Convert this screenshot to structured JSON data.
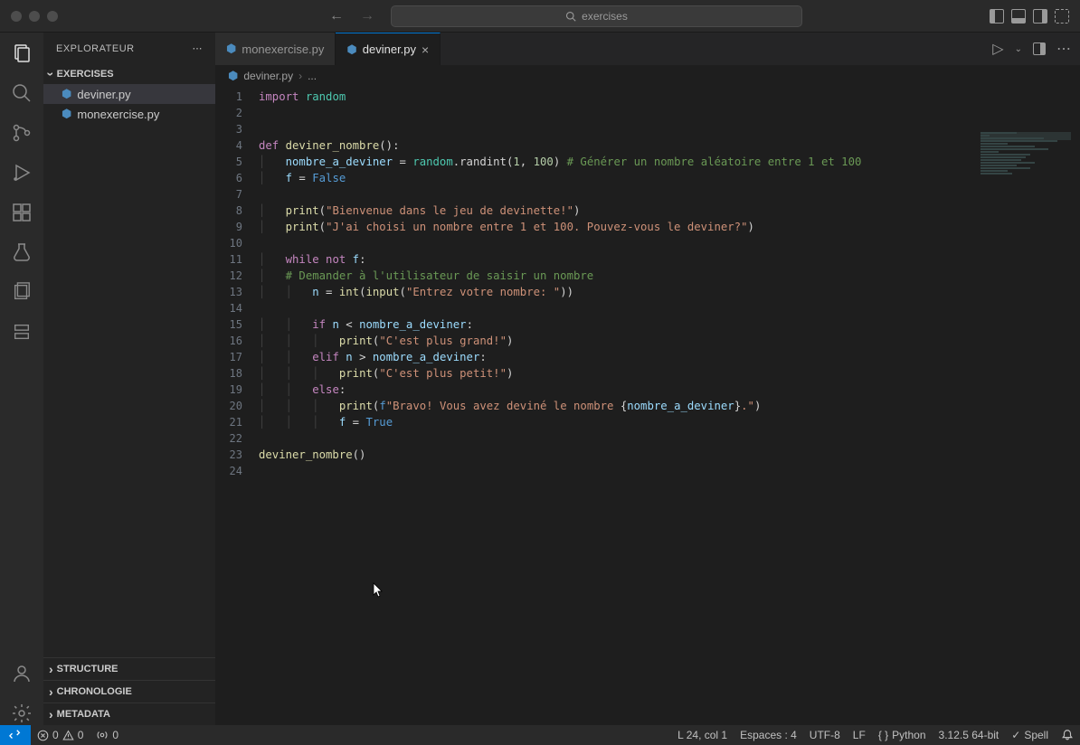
{
  "search": {
    "placeholder": "exercises"
  },
  "sidebar": {
    "title": "EXPLORATEUR",
    "section": "EXERCISES",
    "files": [
      {
        "name": "deviner.py",
        "active": true
      },
      {
        "name": "monexercise.py",
        "active": false
      }
    ],
    "collapsed": [
      "STRUCTURE",
      "CHRONOLOGIE",
      "METADATA"
    ]
  },
  "tabs": [
    {
      "name": "monexercise.py",
      "active": false
    },
    {
      "name": "deviner.py",
      "active": true
    }
  ],
  "breadcrumbs": {
    "file": "deviner.py",
    "more": "..."
  },
  "code_lines": [
    [
      {
        "t": "import ",
        "c": "kw"
      },
      {
        "t": "random",
        "c": "mod"
      }
    ],
    [],
    [],
    [
      {
        "t": "def ",
        "c": "kw"
      },
      {
        "t": "deviner_nombre",
        "c": "fn"
      },
      {
        "t": "():",
        "c": ""
      }
    ],
    [
      {
        "t": "    "
      },
      {
        "t": "nombre_a_deviner",
        "c": "param"
      },
      {
        "t": " = "
      },
      {
        "t": "random",
        "c": "mod"
      },
      {
        "t": ".randint("
      },
      {
        "t": "1",
        "c": "num"
      },
      {
        "t": ", "
      },
      {
        "t": "100",
        "c": "num"
      },
      {
        "t": ") "
      },
      {
        "t": "# Générer un nombre aléatoire entre 1 et 100",
        "c": "com"
      }
    ],
    [
      {
        "t": "    "
      },
      {
        "t": "f",
        "c": "param"
      },
      {
        "t": " = "
      },
      {
        "t": "False",
        "c": "const"
      }
    ],
    [],
    [
      {
        "t": "    "
      },
      {
        "t": "print",
        "c": "fn"
      },
      {
        "t": "("
      },
      {
        "t": "\"Bienvenue dans le jeu de devinette!\"",
        "c": "str"
      },
      {
        "t": ")"
      }
    ],
    [
      {
        "t": "    "
      },
      {
        "t": "print",
        "c": "fn"
      },
      {
        "t": "("
      },
      {
        "t": "\"J'ai choisi un nombre entre 1 et 100. Pouvez-vous le deviner?\"",
        "c": "str"
      },
      {
        "t": ")"
      }
    ],
    [],
    [
      {
        "t": "    "
      },
      {
        "t": "while ",
        "c": "kw"
      },
      {
        "t": "not ",
        "c": "kw"
      },
      {
        "t": "f",
        "c": "param"
      },
      {
        "t": ":"
      }
    ],
    [
      {
        "t": "    "
      },
      {
        "t": "# Demander à l'utilisateur de saisir un nombre",
        "c": "com"
      }
    ],
    [
      {
        "t": "        "
      },
      {
        "t": "n",
        "c": "param"
      },
      {
        "t": " = "
      },
      {
        "t": "int",
        "c": "fn"
      },
      {
        "t": "("
      },
      {
        "t": "input",
        "c": "fn"
      },
      {
        "t": "("
      },
      {
        "t": "\"Entrez votre nombre: \"",
        "c": "str"
      },
      {
        "t": "))"
      }
    ],
    [],
    [
      {
        "t": "        "
      },
      {
        "t": "if ",
        "c": "kw"
      },
      {
        "t": "n",
        "c": "param"
      },
      {
        "t": " < "
      },
      {
        "t": "nombre_a_deviner",
        "c": "param"
      },
      {
        "t": ":"
      }
    ],
    [
      {
        "t": "            "
      },
      {
        "t": "print",
        "c": "fn"
      },
      {
        "t": "("
      },
      {
        "t": "\"C'est plus grand!\"",
        "c": "str"
      },
      {
        "t": ")"
      }
    ],
    [
      {
        "t": "        "
      },
      {
        "t": "elif ",
        "c": "kw"
      },
      {
        "t": "n",
        "c": "param"
      },
      {
        "t": " > "
      },
      {
        "t": "nombre_a_deviner",
        "c": "param"
      },
      {
        "t": ":"
      }
    ],
    [
      {
        "t": "            "
      },
      {
        "t": "print",
        "c": "fn"
      },
      {
        "t": "("
      },
      {
        "t": "\"C'est plus petit!\"",
        "c": "str"
      },
      {
        "t": ")"
      }
    ],
    [
      {
        "t": "        "
      },
      {
        "t": "else",
        "c": "kw"
      },
      {
        "t": ":"
      }
    ],
    [
      {
        "t": "            "
      },
      {
        "t": "print",
        "c": "fn"
      },
      {
        "t": "("
      },
      {
        "t": "f",
        "c": "const"
      },
      {
        "t": "\"Bravo! Vous avez deviné le nombre ",
        "c": "str"
      },
      {
        "t": "{",
        "c": ""
      },
      {
        "t": "nombre_a_deviner",
        "c": "param"
      },
      {
        "t": "}",
        "c": ""
      },
      {
        "t": ".\"",
        "c": "str"
      },
      {
        "t": ")"
      }
    ],
    [
      {
        "t": "            "
      },
      {
        "t": "f",
        "c": "param"
      },
      {
        "t": " = "
      },
      {
        "t": "True",
        "c": "const"
      }
    ],
    [],
    [
      {
        "t": "deviner_nombre",
        "c": "fn"
      },
      {
        "t": "()"
      }
    ],
    []
  ],
  "status": {
    "errors": "0",
    "warnings": "0",
    "ports": "0",
    "position": "L 24, col 1",
    "spaces": "Espaces : 4",
    "encoding": "UTF-8",
    "eol": "LF",
    "lang": "Python",
    "version": "3.12.5 64-bit",
    "spell": "Spell"
  }
}
